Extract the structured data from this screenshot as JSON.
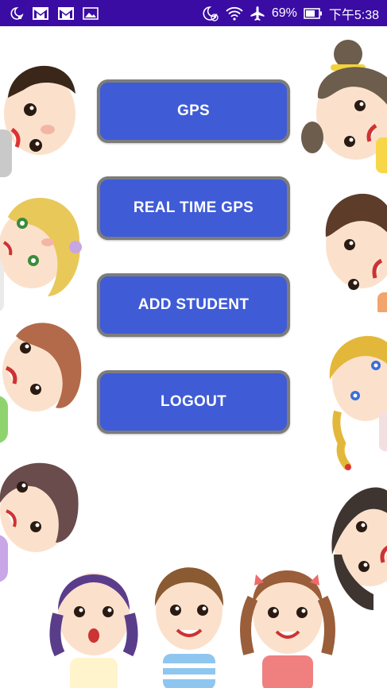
{
  "status_bar": {
    "battery": "69%",
    "time": "下午5:38",
    "left_icons": [
      "moon-notification-icon",
      "gmail-icon",
      "gmail-icon",
      "image-icon"
    ],
    "right_icons": [
      "do-not-disturb-icon",
      "wifi-icon",
      "airplane-icon",
      "battery-icon"
    ]
  },
  "menu": {
    "gps_label": "GPS",
    "real_time_gps_label": "REAL TIME GPS",
    "add_student_label": "ADD STUDENT",
    "logout_label": "LOGOUT"
  },
  "colors": {
    "status_bar": "#3a0ca3",
    "button_fill": "#3f5bd6",
    "button_border": "#7c7c7c",
    "background": "#ffffff"
  }
}
